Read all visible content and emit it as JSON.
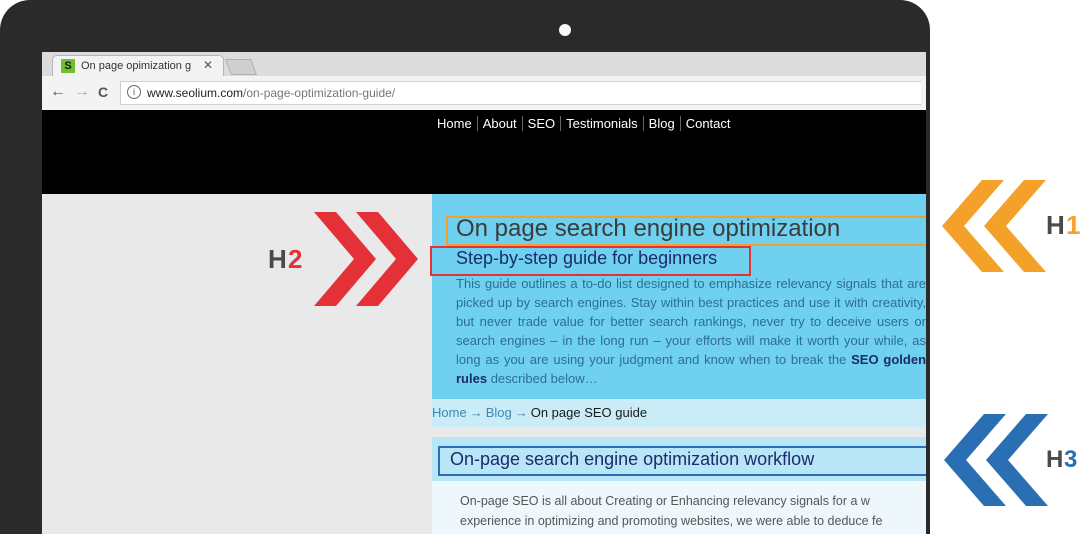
{
  "browser": {
    "tab_title": "On page opimization gu",
    "tab_close": "✕",
    "favicon": "S",
    "url_host": "www.seolium.com",
    "url_path": "/on-page-optimization-guide/",
    "back_icon": "←",
    "forward_icon": "→",
    "reload_icon": "C",
    "info_icon": "i"
  },
  "nav": {
    "items": [
      "Home",
      "About",
      "SEO",
      "Testimonials",
      "Blog",
      "Contact"
    ]
  },
  "hero": {
    "h1": "On page search engine optimization",
    "h2": "Step-by-step guide for beginners",
    "intro_before": "This guide outlines a to-do list designed to emphasize relevancy signals that are picked up by search engines. Stay within best practices and use it with creativity, but never trade value for better search rankings, never try to deceive users or search engines – in the long run – your efforts will make it worth your while, as long as you are using your judgment and know when to break the ",
    "intro_bold": "SEO golden rules",
    "intro_after": " described below…"
  },
  "breadcrumb": {
    "home": "Home",
    "sep": "→",
    "blog": "Blog",
    "current": "On page SEO guide"
  },
  "section": {
    "h3": "On-page search engine optimization workflow",
    "line1": "On-page SEO is all about Creating or Enhancing relevancy signals for a w",
    "line2": "experience in optimizing and promoting websites, we were able to deduce fe"
  },
  "annotations": {
    "h1_label_h": "H",
    "h1_label_n": "1",
    "h2_label_h": "H",
    "h2_label_n": "2",
    "h3_label_h": "H",
    "h3_label_n": "3"
  },
  "colors": {
    "h1_accent": "#f4a12a",
    "h2_accent": "#e33137",
    "h3_accent": "#2a6fb3",
    "hero_bg": "#6fd1ef",
    "nav_bg": "#000000"
  }
}
